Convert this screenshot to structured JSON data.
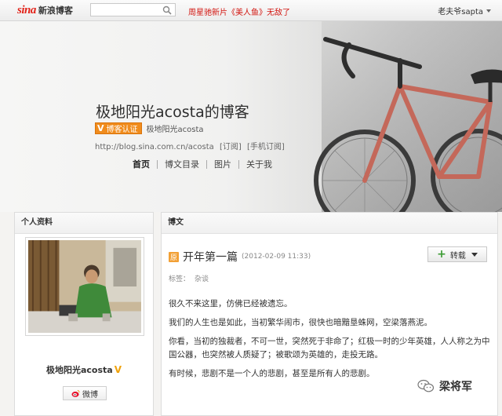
{
  "topbar": {
    "logo_sina": "sina",
    "logo_name": "新浪博客",
    "search_placeholder": "",
    "promo": "周星驰新片《美人鱼》无敌了",
    "user": "老夫爷sapta"
  },
  "header": {
    "blog_title": "极地阳光acosta的博客",
    "verify_mark": "V",
    "verify_label": "博客认证",
    "owner_name": "极地阳光acosta",
    "url": "http://blog.sina.com.cn/acosta",
    "subscribe": "[订阅]",
    "mobile_subscribe": "[手机订阅]",
    "nav": [
      "首页",
      "博文目录",
      "图片",
      "关于我"
    ]
  },
  "profile": {
    "heading": "个人资料",
    "name": "极地阳光acosta",
    "weibo_label": "微博"
  },
  "post": {
    "section_heading": "博文",
    "type_icon": "原",
    "title": "开年第一篇",
    "date": "(2012-02-09 11:33)",
    "forward_label": "转载",
    "tags_label": "标签：",
    "tag": "杂谈",
    "paragraphs": [
      "很久不来这里，仿佛已经被遗忘。",
      "我们的人生也是如此，当初繁华闹市，很快也暗黯垦蛛网，空梁落燕泥。",
      "你看，当初的独裁者，不可一世，突然死于非命了；红极一时的少年英雄，人人称之为中国公器，也突然被人质疑了；被歌颂为英雄的，走投无路。",
      "有时候，悲剧不是一个人的悲剧，甚至是所有人的悲剧。"
    ]
  },
  "watermark": {
    "text": "梁将军"
  },
  "colors": {
    "accent_red": "#d2140f",
    "verify_orange": "#f08c1d",
    "forward_green": "#3a9b32"
  }
}
